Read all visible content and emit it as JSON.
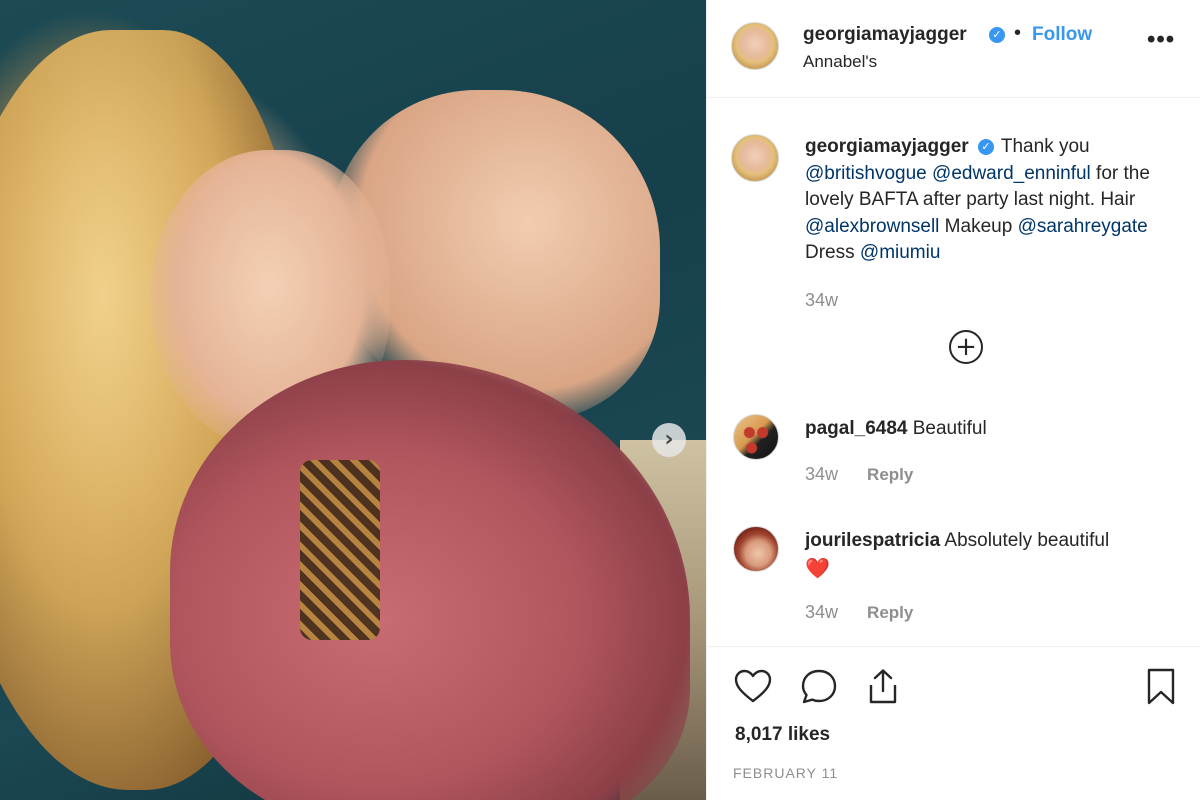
{
  "post": {
    "author": "georgiamayjagger",
    "follow_label": "Follow",
    "separator": "•",
    "location": "Annabel's",
    "more_label": "•••",
    "caption": {
      "author": "georgiamayjagger",
      "parts": [
        {
          "text": " Thank you ",
          "mention": false
        },
        {
          "text": "@britishvogue",
          "mention": true
        },
        {
          "text": " ",
          "mention": false
        },
        {
          "text": "@edward_enninful",
          "mention": true
        },
        {
          "text": " for the lovely BAFTA after party last night. Hair ",
          "mention": false
        },
        {
          "text": "@alexbrownsell",
          "mention": true
        },
        {
          "text": " Makeup ",
          "mention": false
        },
        {
          "text": "@sarahreygate",
          "mention": true
        },
        {
          "text": " Dress ",
          "mention": false
        },
        {
          "text": "@miumiu",
          "mention": true
        }
      ],
      "time": "34w"
    },
    "comments": [
      {
        "user": "pagal_6484",
        "text": "Beautiful",
        "time": "34w",
        "reply_label": "Reply"
      },
      {
        "user": "jourilespatricia",
        "text": "Absolutely beautiful",
        "emoji": "❤️",
        "time": "34w",
        "reply_label": "Reply"
      }
    ],
    "likes": "8,017 likes",
    "date": "FEBRUARY 11"
  },
  "icons": {
    "next": "chevron-right-icon",
    "verified": "verified-badge-icon",
    "load_more": "plus-circle-icon",
    "like": "heart-outline-icon",
    "comment": "speech-bubble-icon",
    "share": "share-upload-icon",
    "save": "bookmark-icon"
  },
  "colors": {
    "accent": "#3897f0",
    "mention": "#003569",
    "muted": "#8e8e8e",
    "text": "#262626"
  }
}
